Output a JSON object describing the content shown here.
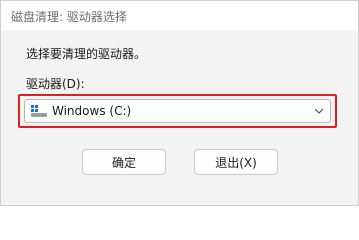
{
  "window": {
    "title": "磁盘清理: 驱动器选择"
  },
  "dialog": {
    "prompt": "选择要清理的驱动器。",
    "drive_label": "驱动器(D):",
    "drive_select": {
      "selected": "Windows (C:)",
      "icon": "drive-icon"
    },
    "buttons": {
      "ok_label": "确定",
      "exit_label": "退出(X)"
    }
  },
  "colors": {
    "highlight": "#e02020",
    "background": "#f3f3f3"
  }
}
